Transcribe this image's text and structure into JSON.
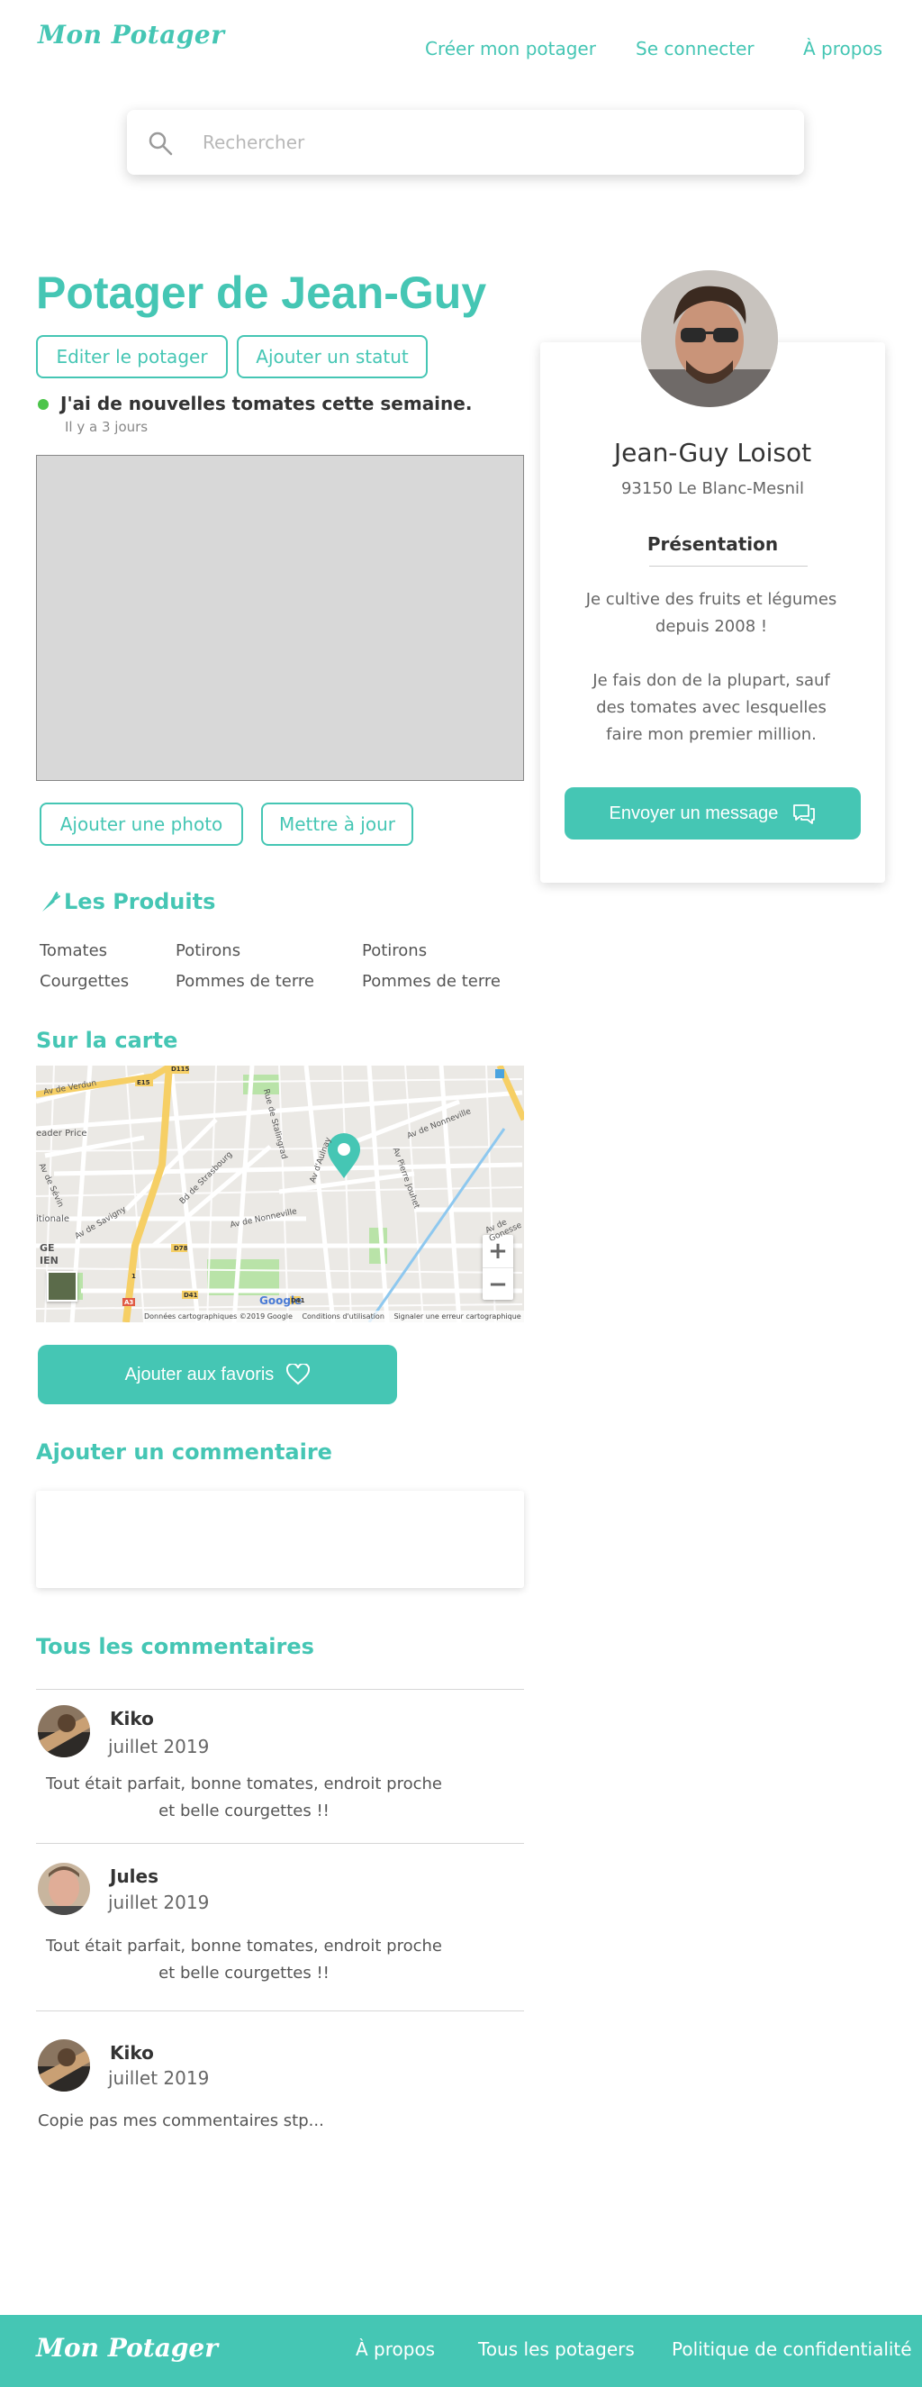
{
  "header": {
    "logo": "Mon Potager",
    "nav": [
      "Créer mon potager",
      "Se connecter",
      "À propos"
    ]
  },
  "search": {
    "placeholder": "Rechercher",
    "icon": "search-icon"
  },
  "garden": {
    "title": "Potager de Jean-Guy",
    "edit_label": "Editer le potager",
    "add_status_label": "Ajouter un statut",
    "status_text": "J'ai de nouvelles tomates cette semaine.",
    "status_time": "Il y a 3 jours",
    "add_photo_label": "Ajouter une photo",
    "update_label": "Mettre à jour"
  },
  "products": {
    "title": "Les Produits",
    "items": [
      "Tomates",
      "Potirons",
      "Potirons",
      "Courgettes",
      "Pommes de terre",
      "Pommes de terre"
    ]
  },
  "map": {
    "title": "Sur la carte",
    "attribution": "Données cartographiques ©2019 Google",
    "terms": "Conditions d'utilisation",
    "report": "Signaler une erreur cartographique",
    "brand": "Google",
    "zoom_in": "+",
    "zoom_out": "−",
    "streets": [
      "Av de Verdun",
      "Av de Nonneville",
      "Rue de Stalingrad",
      "Bd de Strasbourg",
      "Av d'Aulnay",
      "Av de Nonneville",
      "Av Pierre Jouhet",
      "Av de Savigny",
      "Av de Sévin",
      "Av de Gonesse",
      "eader Price",
      "itionale",
      "GE",
      "IEN"
    ],
    "road_badges": [
      "D115",
      "E15",
      "D78",
      "D41",
      "A3",
      "D41",
      "1"
    ]
  },
  "favorites": {
    "label": "Ajouter aux favoris"
  },
  "add_comment": {
    "title": "Ajouter un commentaire"
  },
  "comments": {
    "title": "Tous les commentaires",
    "items": [
      {
        "name": "Kiko",
        "date": "juillet 2019",
        "text": "Tout était parfait, bonne tomates, endroit proche et belle courgettes !!"
      },
      {
        "name": "Jules",
        "date": "juillet 2019",
        "text": "Tout était parfait, bonne tomates, endroit proche et belle courgettes !!"
      },
      {
        "name": "Kiko",
        "date": "juillet 2019",
        "text": "Copie pas mes commentaires stp..."
      }
    ]
  },
  "profile": {
    "name": "Jean-Guy Loisot",
    "location": "93150 Le Blanc-Mesnil",
    "presentation_title": "Présentation",
    "bio_1": "Je cultive des fruits et légumes depuis 2008 !",
    "bio_2": "Je fais don de la plupart, sauf des tomates avec lesquelles faire mon premier million.",
    "message_label": "Envoyer un message"
  },
  "footer": {
    "logo": "Mon Potager",
    "links": [
      "À propos",
      "Tous les potagers",
      "Politique de confidentialité"
    ]
  },
  "colors": {
    "accent": "#45c6b4",
    "status": "#4cc44a",
    "photo_placeholder": "#d8d8d8"
  }
}
